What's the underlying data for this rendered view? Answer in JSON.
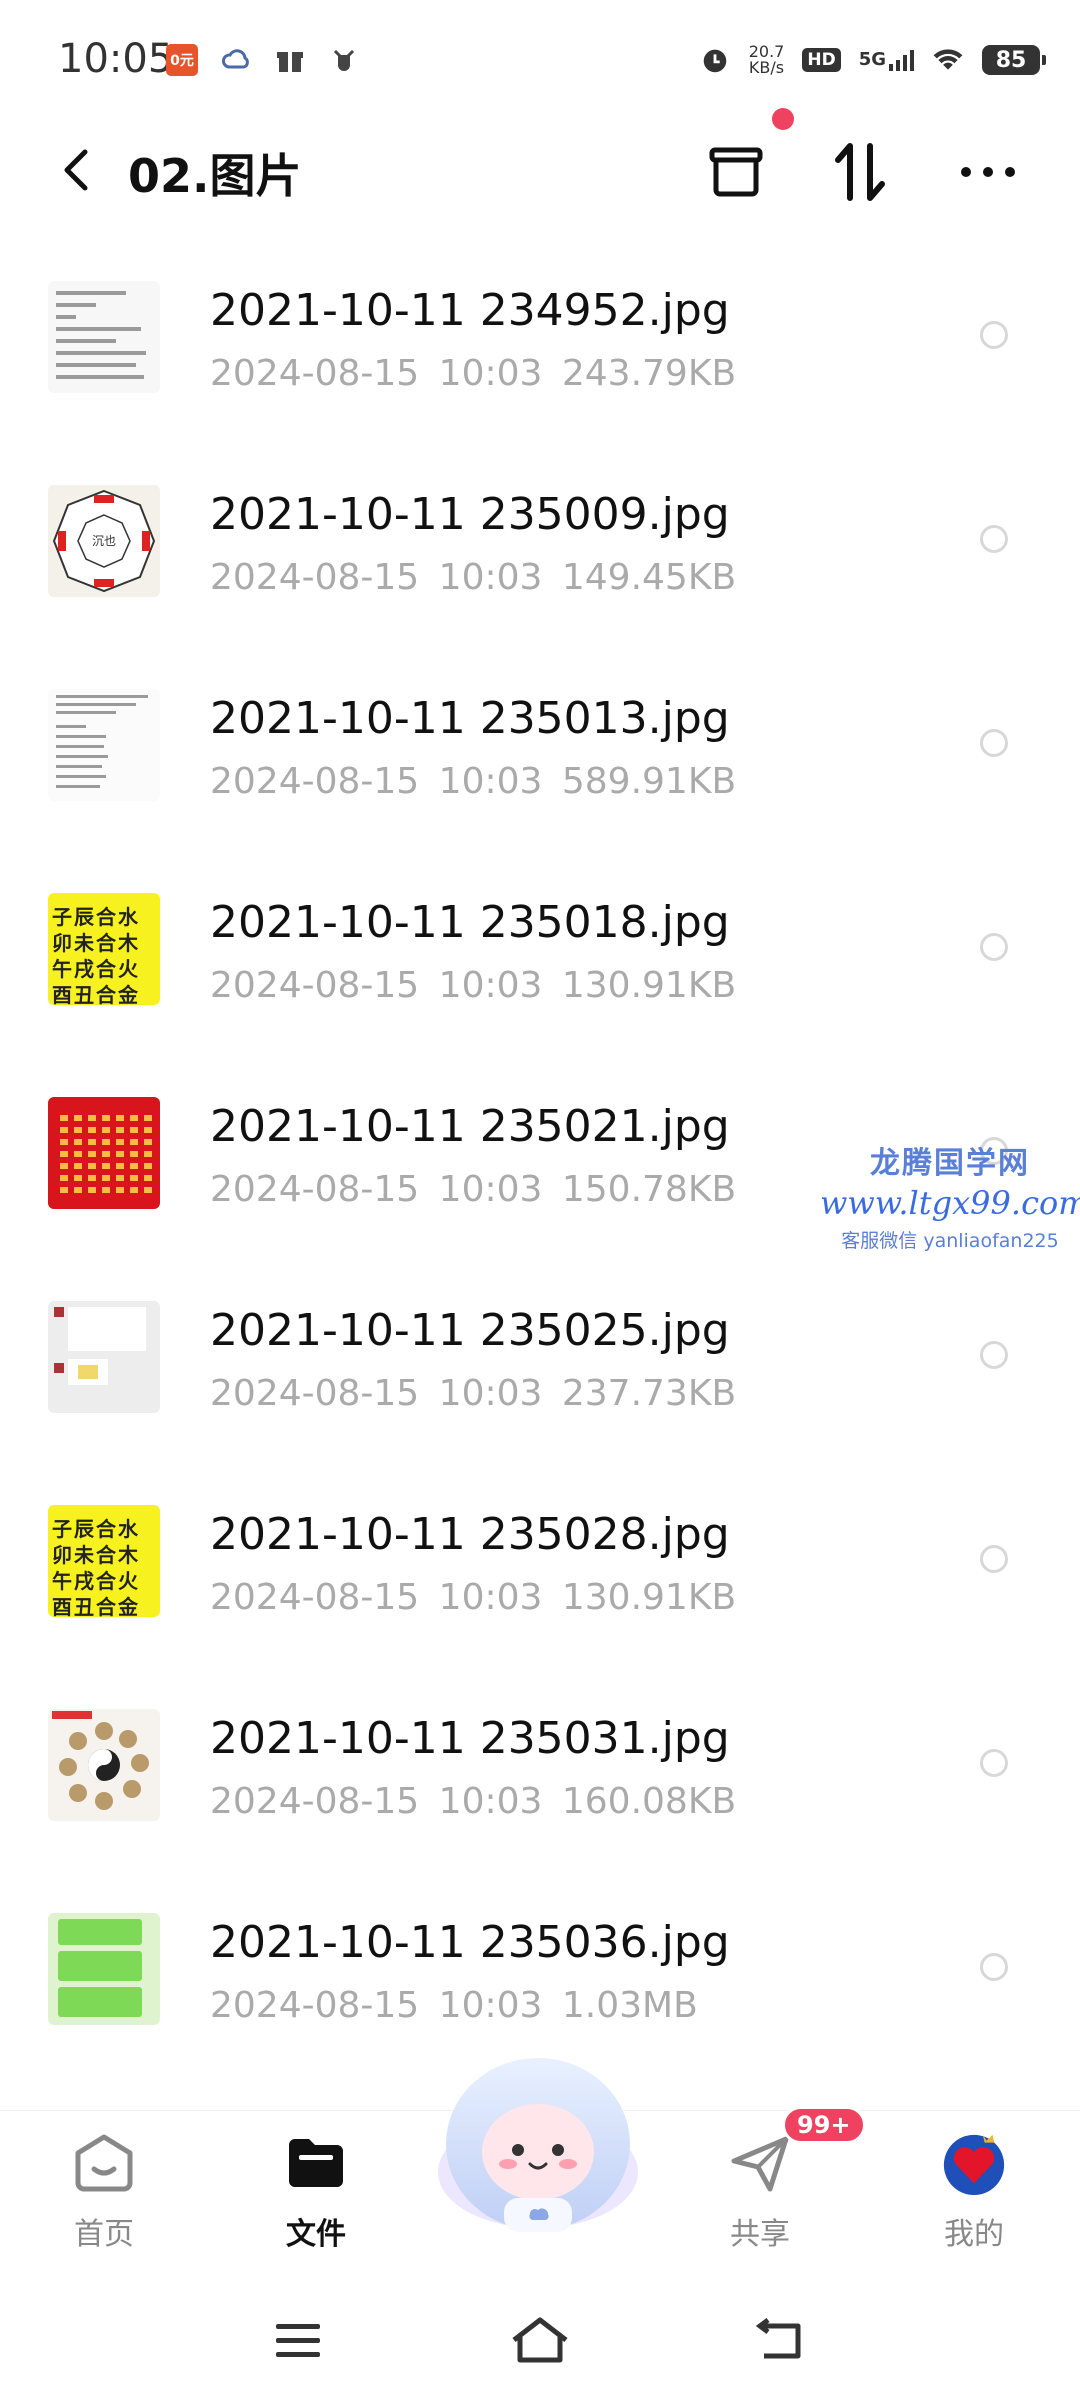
{
  "status_bar": {
    "time": "10:05",
    "app_badge": "0元",
    "net_speed_value": "20.7",
    "net_speed_unit": "KB/s",
    "hd": "HD",
    "network": "5G",
    "battery": "85"
  },
  "header": {
    "title": "02.图片",
    "back_icon": "chevron-left-icon",
    "archive_icon": "archive-icon",
    "sort_icon": "sort-icon",
    "more_icon": "more-icon",
    "notification_dot_color": "#ef4160"
  },
  "files": [
    {
      "name": "2021-10-11 234952.jpg",
      "date": "2024-08-15",
      "time": "10:03",
      "size": "243.79KB",
      "thumb": "text"
    },
    {
      "name": "2021-10-11 235009.jpg",
      "date": "2024-08-15",
      "time": "10:03",
      "size": "149.45KB",
      "thumb": "bagua"
    },
    {
      "name": "2021-10-11 235013.jpg",
      "date": "2024-08-15",
      "time": "10:03",
      "size": "589.91KB",
      "thumb": "text"
    },
    {
      "name": "2021-10-11 235018.jpg",
      "date": "2024-08-15",
      "time": "10:03",
      "size": "130.91KB",
      "thumb": "yellow"
    },
    {
      "name": "2021-10-11 235021.jpg",
      "date": "2024-08-15",
      "time": "10:03",
      "size": "150.78KB",
      "thumb": "red"
    },
    {
      "name": "2021-10-11 235025.jpg",
      "date": "2024-08-15",
      "time": "10:03",
      "size": "237.73KB",
      "thumb": "chat"
    },
    {
      "name": "2021-10-11 235028.jpg",
      "date": "2024-08-15",
      "time": "10:03",
      "size": "130.91KB",
      "thumb": "yellow"
    },
    {
      "name": "2021-10-11 235031.jpg",
      "date": "2024-08-15",
      "time": "10:03",
      "size": "160.08KB",
      "thumb": "zodiac"
    },
    {
      "name": "2021-10-11 235036.jpg",
      "date": "2024-08-15",
      "time": "10:03",
      "size": "1.03MB",
      "thumb": "green"
    }
  ],
  "thumb_text": {
    "yellow_rows": [
      "子辰合水",
      "卯未合木",
      "午戌合火",
      "酉丑合金"
    ],
    "bagua_center": "沉也"
  },
  "watermark": {
    "title": "龙腾国学网",
    "url": "www.ltgx99.com",
    "sub": "客服微信 yanliaofan225"
  },
  "bottom_nav": {
    "items": [
      {
        "label": "首页",
        "icon": "home-icon",
        "active": false
      },
      {
        "label": "文件",
        "icon": "folder-icon",
        "active": true
      },
      {
        "label": "共享",
        "icon": "send-icon",
        "active": false
      },
      {
        "label": "我的",
        "icon": "avatar-icon",
        "active": false
      }
    ],
    "share_badge": "99+",
    "mascot_icon": "mascot-icon"
  },
  "system_nav": {
    "menu_icon": "menu-icon",
    "home_icon": "home-outline-icon",
    "back_icon": "back-icon"
  },
  "colors": {
    "accent_red": "#ef4160",
    "meta_gray": "#aaaaaa",
    "watermark_blue": "#3a6be0"
  }
}
